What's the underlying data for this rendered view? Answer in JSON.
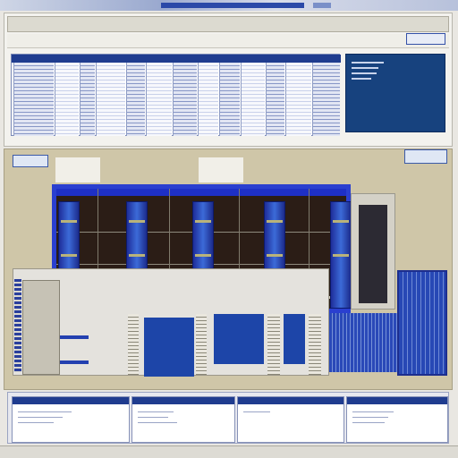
{
  "window": {
    "title": "",
    "header_button": "",
    "mid_left_button": "",
    "mid_right_button": ""
  },
  "table": {
    "columns": [
      "",
      "",
      "",
      "",
      "",
      "",
      "",
      "",
      "",
      "",
      "",
      "",
      ""
    ]
  },
  "info_panel": {
    "lines": [
      "",
      "",
      "",
      ""
    ]
  },
  "cards": [
    {
      "title": "",
      "text": ""
    },
    {
      "title": "",
      "text": ""
    },
    {
      "title": "",
      "text": ""
    },
    {
      "title": "",
      "text": ""
    }
  ],
  "colors": {
    "accent": "#1f3c8f",
    "panel": "#17427e",
    "structure_frame": "#2a3fd0",
    "background": "#cfc6a8"
  }
}
